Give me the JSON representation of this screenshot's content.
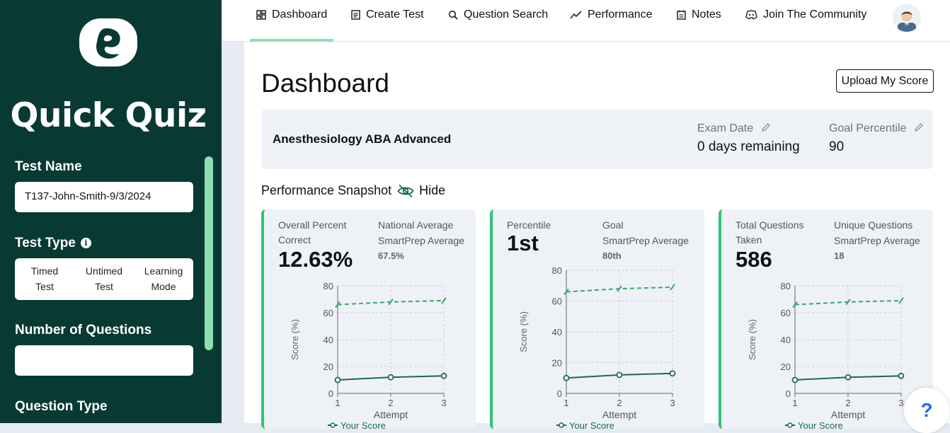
{
  "sidebar": {
    "app_title": "Quick Quiz",
    "test_name_label": "Test Name",
    "test_name_value": "T137-John-Smith-9/3/2024",
    "test_type_label": "Test Type",
    "test_type_options": [
      [
        "Timed",
        "Test"
      ],
      [
        "Untimed",
        "Test"
      ],
      [
        "Learning",
        "Mode"
      ]
    ],
    "num_questions_label": "Number of Questions",
    "num_questions_value": "",
    "question_type_label": "Question Type"
  },
  "nav": {
    "items": [
      {
        "label": "Dashboard",
        "icon": "dashboard-icon"
      },
      {
        "label": "Create Test",
        "icon": "document-icon"
      },
      {
        "label": "Question Search",
        "icon": "search-icon"
      },
      {
        "label": "Performance",
        "icon": "trend-icon"
      },
      {
        "label": "Notes",
        "icon": "notes-icon"
      },
      {
        "label": "Join The Community",
        "icon": "discord-icon"
      }
    ],
    "active": "Dashboard"
  },
  "main": {
    "title": "Dashboard",
    "upload_button": "Upload My Score",
    "exam": {
      "name": "Anesthesiology ABA Advanced",
      "exam_date_label": "Exam Date",
      "exam_date_value": "0 days remaining",
      "goal_label": "Goal Percentile",
      "goal_value": "90"
    },
    "snapshot_label": "Performance Snapshot",
    "hide_label": "Hide"
  },
  "cards": [
    {
      "left_label": "Overall Percent Correct",
      "left_value": "12.63%",
      "right_label_1": "National Average",
      "right_label_2": "SmartPrep Average",
      "right_value": "67.5%"
    },
    {
      "left_label": "Percentile",
      "left_value": "1st",
      "right_label_1": "Goal",
      "right_label_2": "SmartPrep Average",
      "right_value": "80th"
    },
    {
      "left_label": "Total Questions Taken",
      "left_value": "586",
      "right_label_1": "Unique Questions",
      "right_label_2": "SmartPrep Average",
      "right_value": "18"
    }
  ],
  "chart_data": [
    {
      "type": "line",
      "x": [
        1,
        2,
        3
      ],
      "xlabel": "Attempt",
      "ylabel": "Score (%)",
      "ylim": [
        0,
        80
      ],
      "yticks": [
        0,
        20,
        40,
        60,
        80
      ],
      "grid": true,
      "series": [
        {
          "name": "Your Score",
          "values": [
            10,
            12,
            13
          ],
          "style": "solid"
        },
        {
          "name": "",
          "values": [
            66,
            68,
            69
          ],
          "style": "dashed"
        }
      ]
    },
    {
      "type": "line",
      "x": [
        1,
        2,
        3
      ],
      "xlabel": "Attempt",
      "ylabel": "Score (%)",
      "ylim": [
        0,
        80
      ],
      "yticks": [
        0,
        20,
        40,
        60,
        80
      ],
      "grid": true,
      "series": [
        {
          "name": "Your Score",
          "values": [
            10,
            12,
            13
          ],
          "style": "solid"
        },
        {
          "name": "",
          "values": [
            66,
            68,
            69
          ],
          "style": "dashed"
        }
      ]
    },
    {
      "type": "line",
      "x": [
        1,
        2,
        3
      ],
      "xlabel": "Attempt",
      "ylabel": "Score (%)",
      "ylim": [
        0,
        80
      ],
      "yticks": [
        0,
        20,
        40,
        60,
        80
      ],
      "grid": true,
      "series": [
        {
          "name": "Your Score",
          "values": [
            10,
            12,
            13
          ],
          "style": "solid"
        },
        {
          "name": "",
          "values": [
            66,
            68,
            69
          ],
          "style": "dashed"
        }
      ]
    }
  ],
  "colors": {
    "sidebar": "#083a33",
    "accent": "#8fdfb0",
    "card_border": "#2fc27a",
    "line_solid": "#1b6b4a",
    "line_dashed": "#3aa66b"
  }
}
